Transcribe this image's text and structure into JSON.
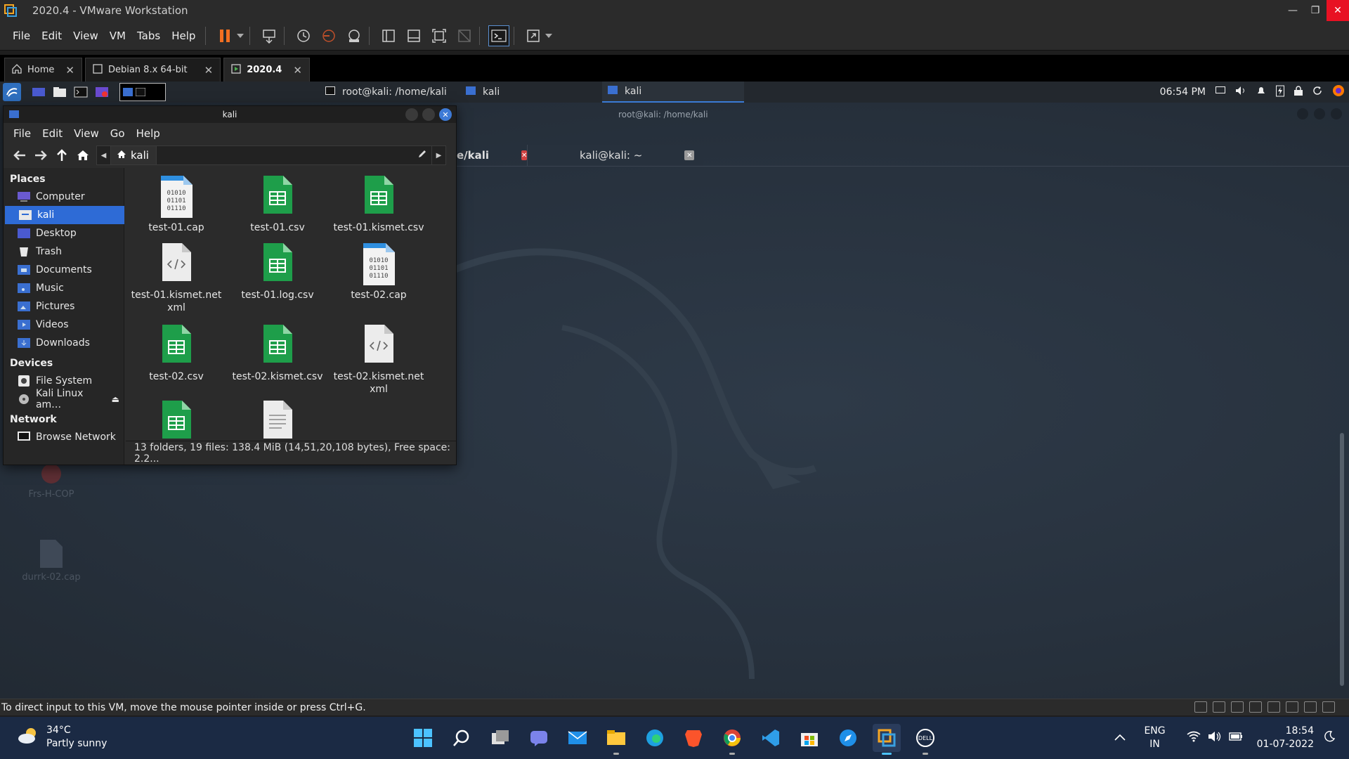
{
  "vmware": {
    "title": "2020.4 - VMware Workstation",
    "menu": [
      "File",
      "Edit",
      "View",
      "VM",
      "Tabs",
      "Help"
    ],
    "tabs": [
      {
        "label": "Home",
        "active": false
      },
      {
        "label": "Debian 8.x 64-bit",
        "active": false
      },
      {
        "label": "2020.4",
        "active": true
      }
    ],
    "status_text": "To direct input to this VM, move the mouse pointer inside or press Ctrl+G."
  },
  "kali_panel": {
    "tasks": [
      {
        "label": "root@kali: /home/kali",
        "active": false
      },
      {
        "label": "kali",
        "active": false
      },
      {
        "label": "kali",
        "active": true
      }
    ],
    "clock": "06:54 PM"
  },
  "terminal": {
    "title": "root@kali: /home/kali",
    "tabs": [
      {
        "label": "e/kali"
      },
      {
        "label": "kali@kali: ~"
      }
    ]
  },
  "desktop_icons": [
    {
      "label": "Frs-H-COP"
    },
    {
      "label": "durrk-02.cap"
    }
  ],
  "file_manager": {
    "title": "kali",
    "menu": [
      "File",
      "Edit",
      "View",
      "Go",
      "Help"
    ],
    "path": "kali",
    "sidebar": {
      "places_heading": "Places",
      "places": [
        {
          "label": "Computer",
          "icon": "computer-icon"
        },
        {
          "label": "kali",
          "icon": "home-folder-icon",
          "selected": true
        },
        {
          "label": "Desktop",
          "icon": "desktop-icon"
        },
        {
          "label": "Trash",
          "icon": "trash-icon"
        },
        {
          "label": "Documents",
          "icon": "documents-icon"
        },
        {
          "label": "Music",
          "icon": "music-icon"
        },
        {
          "label": "Pictures",
          "icon": "pictures-icon"
        },
        {
          "label": "Videos",
          "icon": "videos-icon"
        },
        {
          "label": "Downloads",
          "icon": "downloads-icon"
        }
      ],
      "devices_heading": "Devices",
      "devices": [
        {
          "label": "File System",
          "icon": "drive-icon"
        },
        {
          "label": "Kali Linux am…",
          "icon": "disc-icon"
        }
      ],
      "network_heading": "Network",
      "network": [
        {
          "label": "Browse Network",
          "icon": "network-icon"
        }
      ]
    },
    "files": [
      {
        "name": "test-01.cap",
        "type": "binary"
      },
      {
        "name": "test-01.csv",
        "type": "spreadsheet"
      },
      {
        "name": "test-01.kismet.csv",
        "type": "spreadsheet"
      },
      {
        "name": "test-01.kismet.netxml",
        "type": "xml"
      },
      {
        "name": "test-01.log.csv",
        "type": "spreadsheet"
      },
      {
        "name": "test-02.cap",
        "type": "binary"
      },
      {
        "name": "test-02.csv",
        "type": "spreadsheet"
      },
      {
        "name": "test-02.kismet.csv",
        "type": "spreadsheet"
      },
      {
        "name": "test-02.kismet.netxml",
        "type": "xml"
      },
      {
        "name": "",
        "type": "spreadsheet"
      },
      {
        "name": "",
        "type": "text"
      }
    ],
    "status": "13 folders, 19 files: 138.4 MiB (14,51,20,108 bytes), Free space: 2.2..."
  },
  "taskbar": {
    "weather_temp": "34°C",
    "weather_desc": "Partly sunny",
    "lang_top": "ENG",
    "lang_bottom": "IN",
    "time": "18:54",
    "date": "01-07-2022"
  },
  "colors": {
    "selection": "#2e6bd6",
    "spreadsheet_green": "#1e9e4a",
    "taskbar": "#1b2a44",
    "desktop": "#27313d"
  }
}
